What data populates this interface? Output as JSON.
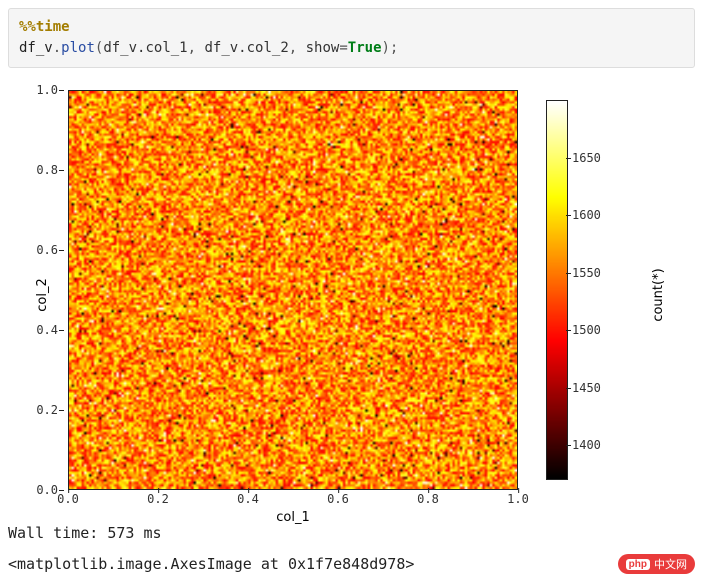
{
  "code": {
    "magic": "%%time",
    "obj": "df_v",
    "method": "plot",
    "arg1": "df_v.col_1",
    "arg2": "df_v.col_2",
    "kw": "show",
    "kwval": "True"
  },
  "chart_data": {
    "type": "heatmap",
    "xlabel": "col_1",
    "ylabel": "col_2",
    "xlim": [
      0.0,
      1.0
    ],
    "ylim": [
      0.0,
      1.0
    ],
    "xticks": [
      0.0,
      0.2,
      0.4,
      0.6,
      0.8,
      1.0
    ],
    "yticks": [
      0.0,
      0.2,
      0.4,
      0.6,
      0.8,
      1.0
    ],
    "colorbar": {
      "label": "count(*)",
      "ticks": [
        1400,
        1450,
        1500,
        1550,
        1600,
        1650
      ],
      "range": [
        1370,
        1700
      ]
    },
    "note": "2D histogram of uniform random points in [0,1]^2; counts per bin roughly 1370–1700 (noise-like orange texture)."
  },
  "output": {
    "wall_time": "Wall time: 573 ms",
    "repr": "<matplotlib.image.AxesImage at 0x1f7e848d978>"
  },
  "watermark": {
    "php": "php",
    "text": "中文网"
  }
}
